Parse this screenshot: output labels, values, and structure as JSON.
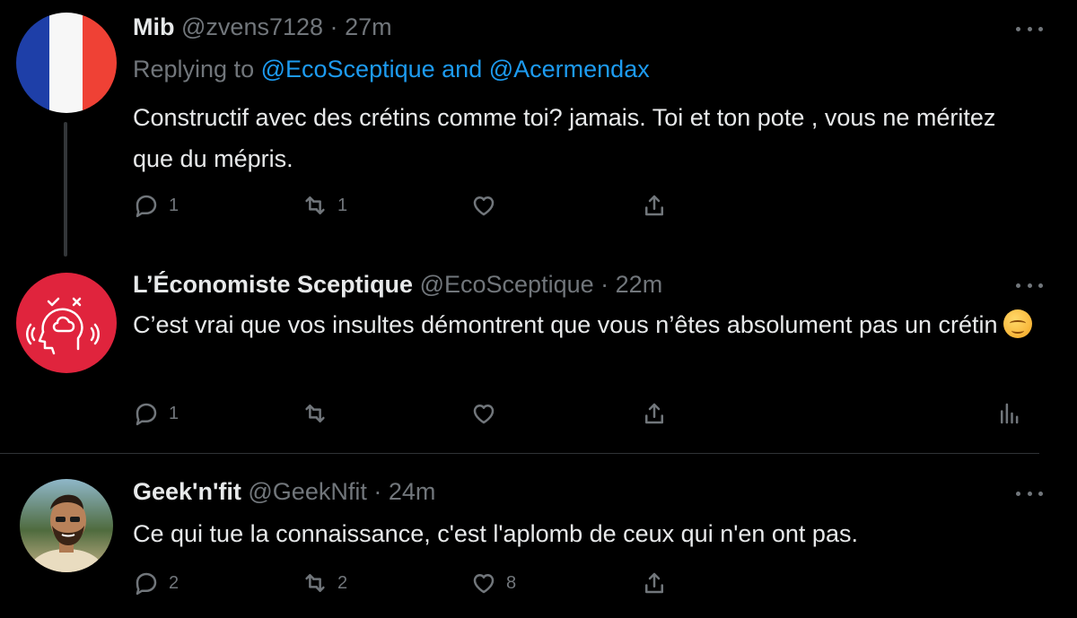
{
  "tweets": [
    {
      "name": "Mib",
      "handle": "@zvens7128",
      "time": "27m",
      "reply_prefix": "Replying to",
      "reply_user1": "@EcoSceptique",
      "reply_and": "and",
      "reply_user2": "@Acermendax",
      "text": "Constructif avec des crétins comme toi? jamais. Toi et ton pote , vous ne méritez que du mépris.",
      "replies": "1",
      "retweets": "1",
      "likes": ""
    },
    {
      "name": "L’Économiste Sceptique",
      "handle": "@EcoSceptique",
      "time": "22m",
      "text": "C’est vrai que vos insultes démontrent que vous n’êtes absolument pas un crétin",
      "replies": "1",
      "retweets": "",
      "likes": ""
    },
    {
      "name": "Geek'n'fit",
      "handle": "@GeekNfit",
      "time": "24m",
      "text": "Ce qui tue la connaissance, c'est l'aplomb de ceux qui n'en ont pas.",
      "replies": "2",
      "retweets": "2",
      "likes": "8"
    }
  ],
  "separator": "·",
  "colors": {
    "background": "#000000",
    "link": "#1d9bf0",
    "muted": "#71767b",
    "logo_red": "#e0243d"
  },
  "icons": [
    "reply-icon",
    "retweet-icon",
    "like-icon",
    "share-icon",
    "analytics-icon",
    "more-icon"
  ]
}
